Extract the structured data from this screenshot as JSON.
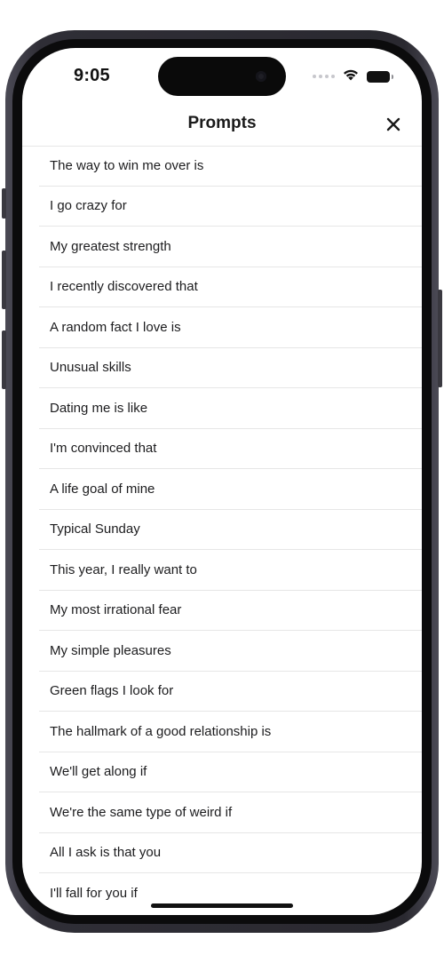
{
  "status_bar": {
    "time": "9:05",
    "wifi_icon": "wifi-icon",
    "battery_icon": "battery-icon",
    "signal_icon": "signal-dots-icon"
  },
  "header": {
    "title": "Prompts",
    "close_icon": "close-icon"
  },
  "prompts": [
    {
      "label": "The way to win me over is"
    },
    {
      "label": "I go crazy for"
    },
    {
      "label": "My greatest strength"
    },
    {
      "label": "I recently discovered that"
    },
    {
      "label": "A random fact I love is"
    },
    {
      "label": "Unusual skills"
    },
    {
      "label": "Dating me is like"
    },
    {
      "label": "I'm convinced that"
    },
    {
      "label": "A life goal of mine"
    },
    {
      "label": "Typical Sunday"
    },
    {
      "label": "This year, I really want to"
    },
    {
      "label": "My most irrational fear"
    },
    {
      "label": "My simple pleasures"
    },
    {
      "label": "Green flags I look for"
    },
    {
      "label": "The hallmark of a good relationship is"
    },
    {
      "label": "We'll get along if"
    },
    {
      "label": "We're the same type of weird if"
    },
    {
      "label": "All I ask is that you"
    },
    {
      "label": "I'll fall for you if"
    }
  ],
  "colors": {
    "text": "#1c1c1e",
    "divider": "#e6e6e6",
    "frame": "#2f2e36"
  }
}
